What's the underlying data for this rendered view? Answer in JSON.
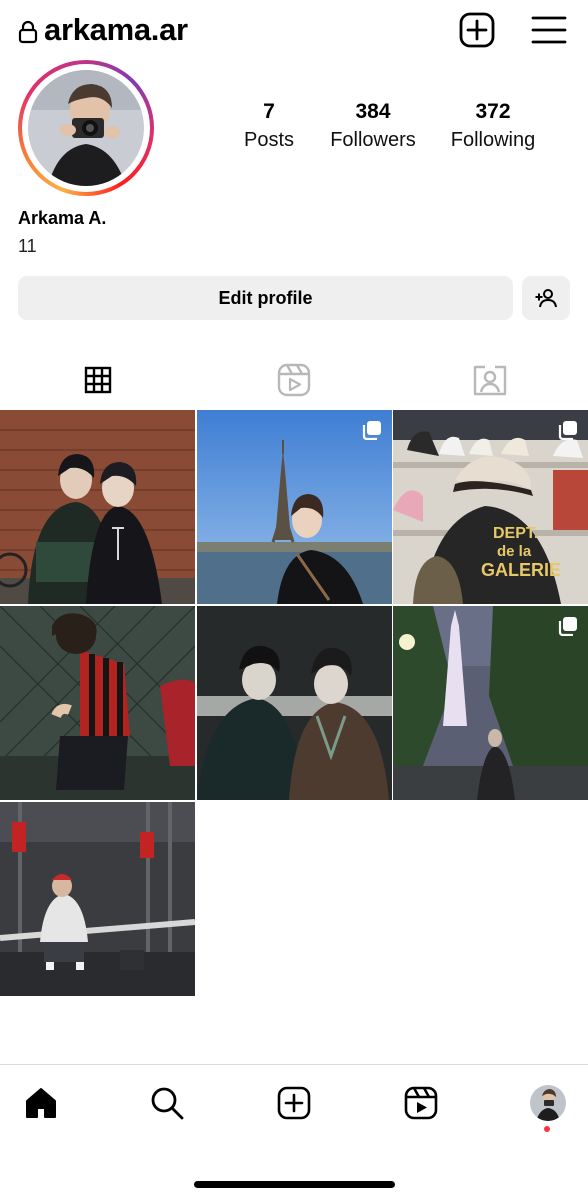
{
  "header": {
    "username": "arkama.ar",
    "lock_icon": "lock-icon",
    "new_post_icon": "plus-square-icon",
    "menu_icon": "hamburger-menu-icon"
  },
  "profile": {
    "avatar_icon": "profile-avatar",
    "stats": [
      {
        "value": "7",
        "label": "Posts"
      },
      {
        "value": "384",
        "label": "Followers"
      },
      {
        "value": "372",
        "label": "Following"
      }
    ],
    "full_name": "Arkama A.",
    "bio": "11",
    "edit_label": "Edit profile",
    "suggest_icon": "add-person-icon"
  },
  "tabs": [
    {
      "icon": "grid-icon",
      "selected": true
    },
    {
      "icon": "reels-icon",
      "selected": false
    },
    {
      "icon": "tagged-icon",
      "selected": false
    }
  ],
  "posts": [
    {
      "scene": "two people by brick wall",
      "multi": false
    },
    {
      "scene": "person by eiffel tower",
      "multi": true
    },
    {
      "scene": "person in galerie shirt at shoe shelf",
      "multi": true
    },
    {
      "scene": "boy in striped jersey",
      "multi": false
    },
    {
      "scene": "two people in caps at night",
      "multi": false
    },
    {
      "scene": "tokyo tower night",
      "multi": true
    },
    {
      "scene": "gym machine",
      "multi": false
    }
  ],
  "photo_text": {
    "shirt_line1": "DEPT.",
    "shirt_line2": "de la",
    "shirt_line3": "GALERIE"
  },
  "bottom_nav": [
    "home-icon",
    "search-icon",
    "create-icon",
    "reels-icon",
    "profile-icon"
  ],
  "colors": {
    "button_bg": "#efefef",
    "divider": "#dbdbdb",
    "notification": "#ff3040"
  }
}
